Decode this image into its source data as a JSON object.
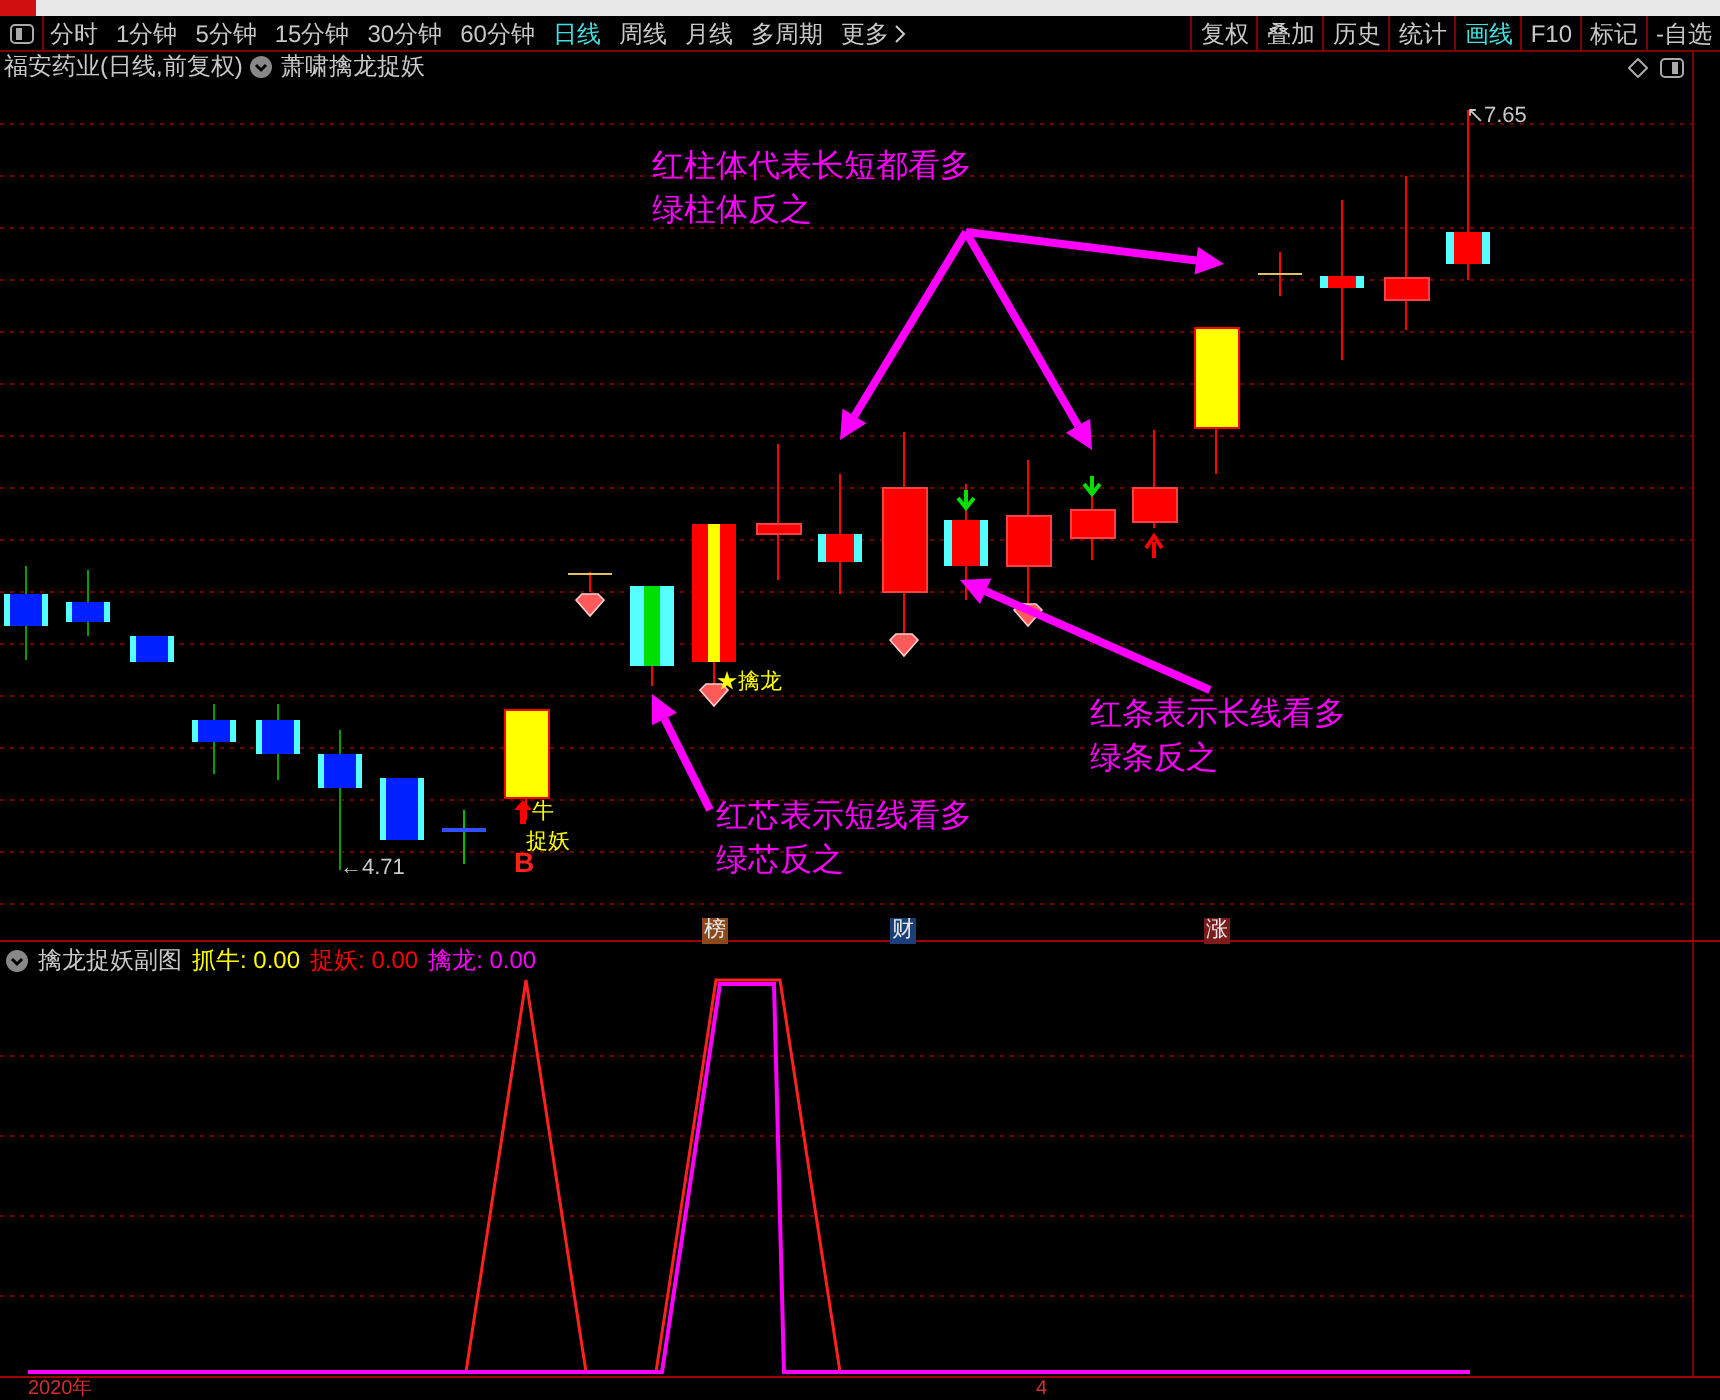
{
  "toolbar": {
    "periods": [
      {
        "label": "分时",
        "selected": false
      },
      {
        "label": "1分钟",
        "selected": false
      },
      {
        "label": "5分钟",
        "selected": false
      },
      {
        "label": "15分钟",
        "selected": false
      },
      {
        "label": "30分钟",
        "selected": false
      },
      {
        "label": "60分钟",
        "selected": false
      },
      {
        "label": "日线",
        "selected": true
      },
      {
        "label": "周线",
        "selected": false
      },
      {
        "label": "月线",
        "selected": false
      },
      {
        "label": "多周期",
        "selected": false
      },
      {
        "label": "更多",
        "selected": false
      }
    ],
    "tools": [
      {
        "label": "复权",
        "selected": false
      },
      {
        "label": "叠加",
        "selected": false
      },
      {
        "label": "历史",
        "selected": false
      },
      {
        "label": "统计",
        "selected": false
      },
      {
        "label": "画线",
        "selected": true
      },
      {
        "label": "F10",
        "selected": false
      },
      {
        "label": "标记",
        "selected": false
      },
      {
        "label": "-自选",
        "selected": false
      }
    ]
  },
  "title": {
    "stock": "福安药业(日线,前复权)",
    "indicator": "萧啸擒龙捉妖"
  },
  "main_chart": {
    "low_label": "←4.71",
    "high_label": "↖7.65",
    "signals": [
      {
        "kind": "bull",
        "text": "牛"
      },
      {
        "kind": "catch",
        "text": "捉妖"
      },
      {
        "kind": "buy",
        "text": "B"
      },
      {
        "kind": "dragon",
        "text": "★擒龙"
      }
    ],
    "annotations": [
      {
        "lines": [
          "红柱体代表长短都看多",
          "绿柱体反之"
        ]
      },
      {
        "lines": [
          "红条表示长线看多",
          "绿条反之"
        ]
      },
      {
        "lines": [
          "红芯表示短线看多",
          "绿芯反之"
        ]
      }
    ],
    "badges": [
      {
        "text": "榜",
        "color": "#8b4a1c"
      },
      {
        "text": "财",
        "color": "#1c3f7a"
      },
      {
        "text": "涨",
        "color": "#7a1c1c"
      }
    ]
  },
  "sub_chart": {
    "title": "擒龙捉妖副图",
    "values": [
      {
        "text": "抓牛: 0.00",
        "color": "#ffff00"
      },
      {
        "text": "捉妖: 0.00",
        "color": "#ff0000"
      },
      {
        "text": "擒龙: 0.00",
        "color": "#ff00ff"
      }
    ]
  },
  "axis": {
    "labels": [
      "2020年",
      "4"
    ]
  }
}
